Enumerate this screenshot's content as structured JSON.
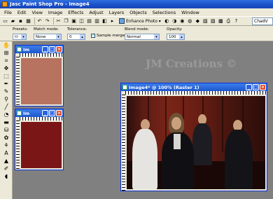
{
  "titlebar": {
    "title": "Jasc Paint Shop Pro - Image4"
  },
  "menu": [
    "File",
    "Edit",
    "View",
    "Image",
    "Effects",
    "Adjust",
    "Layers",
    "Objects",
    "Selections",
    "Window"
  ],
  "toolbar": {
    "enhance_label": "Enhance Photo",
    "tab_label": "ChadV"
  },
  "options": {
    "presets_label": "Presets:",
    "match_mode_label": "Match mode:",
    "match_mode_value": "None",
    "tolerance_label": "Tolerance:",
    "tolerance_value": "0",
    "sample_merged_label": "Sample merged",
    "blend_mode_label": "Blend mode:",
    "blend_mode_value": "Normal",
    "opacity_label": "Opacity:",
    "opacity_value": "100"
  },
  "colors": {
    "swatch1": "#b87260",
    "swatch2": "#7b1616"
  },
  "windows": {
    "small_title": "Im",
    "image_title": "Image4* @ 100% (Raster 1)"
  },
  "watermark": "JM Creations ©"
}
